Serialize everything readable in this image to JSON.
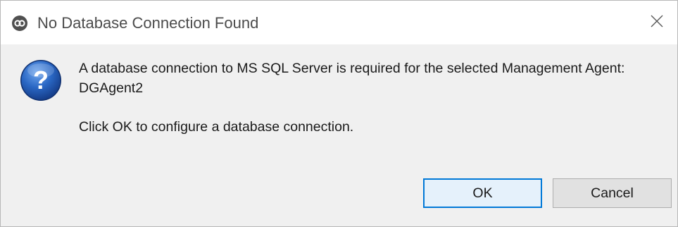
{
  "window": {
    "title": "No Database Connection Found",
    "app_icon": "eclipse-style-app-icon",
    "close_icon": "close-x-icon"
  },
  "dialog": {
    "icon": "question-icon",
    "message_line1": "A database connection to MS SQL Server is required for the selected Management Agent: DGAgent2",
    "message_line2": "Click OK to configure a database connection."
  },
  "buttons": {
    "ok_label": "OK",
    "cancel_label": "Cancel"
  },
  "colors": {
    "accent": "#0078d7",
    "dialog_bg": "#f0f0f0",
    "question_blue": "#1e5fb4"
  }
}
